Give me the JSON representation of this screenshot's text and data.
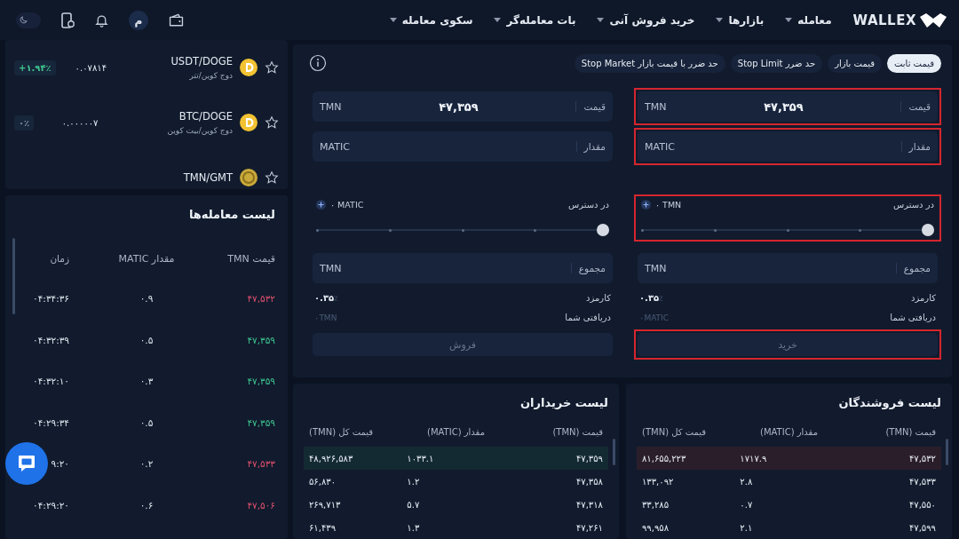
{
  "header": {
    "logo": "WALLEX",
    "nav": [
      "معامله",
      "بازارها",
      "خرید فروش آنی",
      "بات معامله‌گر",
      "سکوی معامله"
    ],
    "avatar": "م",
    "dark_mode": true
  },
  "markets": [
    {
      "pair": "USDT/DOGE",
      "name": "دوج کوین/تتر",
      "price": "۰.۰۷۸۱۴",
      "change": "+۱.۹۴٪",
      "color": "#3ec48f"
    },
    {
      "pair": "BTC/DOGE",
      "name": "دوج کوین/بیت کوین",
      "price": "۰.۰۰۰۰۰۷",
      "change": "۰٪",
      "color": "#8c97ab"
    },
    {
      "pair": "TMN/GMT"
    }
  ],
  "trades": {
    "title": "لیست معامله‌ها",
    "columns": [
      "قیمت TMN",
      "مقدار MATIC",
      "زمان"
    ],
    "rows": [
      {
        "price": "۴۷,۵۳۲",
        "amount": "۰.۹",
        "time": "۰۴:۳۴:۳۶",
        "color": "#e0506e"
      },
      {
        "price": "۴۷,۳۵۹",
        "amount": "۰.۵",
        "time": "۰۴:۳۲:۳۹",
        "color": "#3ec48f"
      },
      {
        "price": "۴۷,۳۵۹",
        "amount": "۰.۳",
        "time": "۰۴:۳۲:۱۰",
        "color": "#3ec48f"
      },
      {
        "price": "۴۷,۳۵۹",
        "amount": "۰.۵",
        "time": "۰۴:۲۹:۳۴",
        "color": "#3ec48f"
      },
      {
        "price": "۴۷,۵۳۳",
        "amount": "۰.۲",
        "time": "۹:۲۰",
        "color": "#e0506e"
      },
      {
        "price": "۴۷,۵۰۶",
        "amount": "۰.۶",
        "time": "۰۴:۲۹:۲۰",
        "color": "#e0506e"
      }
    ]
  },
  "order_form": {
    "tabs": [
      {
        "label": "قیمت ثابت",
        "selected": true
      },
      {
        "label": "قیمت بازار",
        "selected": false
      },
      {
        "label": "حد ضرر Stop Limit",
        "selected": false
      },
      {
        "label": "حد ضرر با قیمت بازار Stop Market",
        "selected": false
      }
    ],
    "sides": [
      {
        "annotated": true,
        "price_label": "قیمت",
        "price": "۴۷,۳۵۹",
        "price_unit": "TMN",
        "amount_label": "مقدار",
        "amount_unit": "MATIC",
        "available_label": "در دسترس",
        "available": "۰ TMN",
        "level": 1,
        "total_label": "مجموع",
        "total_unit": "TMN",
        "fee_label": "کارمزد",
        "fee": "۰.۳۵",
        "fee_unit": "٪",
        "receive_label": "دریافتی شما",
        "receive": "۰",
        "receive_unit": "MATIC",
        "button": "خرید",
        "disabled": true
      },
      {
        "annotated": false,
        "price_label": "قیمت",
        "price": "۴۷,۳۵۹",
        "price_unit": "TMN",
        "amount_label": "مقدار",
        "amount_unit": "MATIC",
        "available_label": "در دسترس",
        "available": "۰ MATIC",
        "level": 1,
        "total_label": "مجموع",
        "total_unit": "TMN",
        "fee_label": "کارمزد",
        "fee": "۰.۳۵",
        "fee_unit": "٪",
        "receive_label": "دریافتی شما",
        "receive": "۰",
        "receive_unit": "TMN",
        "button": "فروش",
        "disabled": true
      }
    ]
  },
  "books": [
    {
      "title": "لیست فروشندگان",
      "color": "#2a1e2a",
      "columns": [
        "قیمت (TMN)",
        "مقدار (MATIC)",
        "قیمت کل (TMN)"
      ],
      "rows": [
        {
          "price": "۴۷,۵۳۲",
          "amount": "۱۷۱۷.۹",
          "total": "۸۱,۶۵۵,۲۲۳",
          "highlighted": true
        },
        {
          "price": "۴۷,۵۳۳",
          "amount": "۲.۸",
          "total": "۱۳۳,۰۹۲",
          "highlighted": false
        },
        {
          "price": "۴۷,۵۵۰",
          "amount": "۰.۷",
          "total": "۳۳,۲۸۵",
          "highlighted": false
        },
        {
          "price": "۴۷,۵۹۹",
          "amount": "۲.۱",
          "total": "۹۹,۹۵۸",
          "highlighted": false
        }
      ]
    },
    {
      "title": "لیست خریداران",
      "color": "#142a33",
      "columns": [
        "قیمت (TMN)",
        "مقدار (MATIC)",
        "قیمت کل (TMN)"
      ],
      "rows": [
        {
          "price": "۴۷,۳۵۹",
          "amount": "۱۰۳۳.۱",
          "total": "۴۸,۹۲۶,۵۸۳",
          "highlighted": true
        },
        {
          "price": "۴۷,۳۵۸",
          "amount": "۱.۲",
          "total": "۵۶,۸۳۰",
          "highlighted": false
        },
        {
          "price": "۴۷,۳۱۸",
          "amount": "۵.۷",
          "total": "۲۶۹,۷۱۳",
          "highlighted": false
        },
        {
          "price": "۴۷,۲۶۱",
          "amount": "۱.۳",
          "total": "۶۱,۴۳۹",
          "highlighted": false
        }
      ]
    }
  ]
}
